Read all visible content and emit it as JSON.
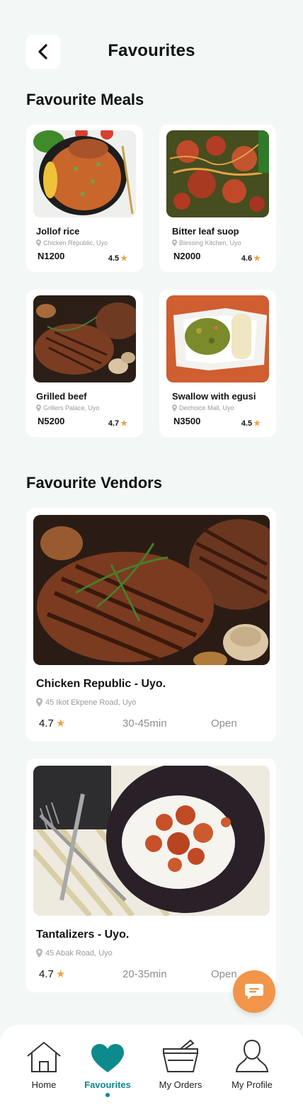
{
  "header": {
    "title": "Favourites"
  },
  "sections": {
    "meals_title": "Favourite Meals",
    "vendors_title": "Favourite Vendors"
  },
  "meals": [
    {
      "name": "Jollof rice",
      "vendor": "Chicken Republic, Uyo",
      "price": "N1200",
      "rating": "4.5"
    },
    {
      "name": "Bitter leaf suop",
      "vendor": "Blessing Kitchen, Uyo",
      "price": "N2000",
      "rating": "4.6"
    },
    {
      "name": "Grilled beef",
      "vendor": "Grillers Palace, Uyo",
      "price": "N5200",
      "rating": "4.7"
    },
    {
      "name": "Swallow with egusi",
      "vendor": "Dechoice Mall, Uyo",
      "price": "N3500",
      "rating": "4.5"
    }
  ],
  "vendors": [
    {
      "name": "Chicken Republic - Uyo.",
      "address": "45 Ikot Ekpene Road, Uyo",
      "rating": "4.7",
      "time": "30-45min",
      "status": "Open"
    },
    {
      "name": "Tantalizers - Uyo.",
      "address": "45 Abak Road, Uyo",
      "rating": "4.7",
      "time": "20-35min",
      "status": "Open"
    }
  ],
  "nav": [
    {
      "label": "Home",
      "icon": "home-icon"
    },
    {
      "label": "Favourites",
      "icon": "heart-icon"
    },
    {
      "label": "My Orders",
      "icon": "basket-icon"
    },
    {
      "label": "My Profile",
      "icon": "user-icon"
    }
  ],
  "colors": {
    "accent": "#0d8a8c",
    "star": "#f0a046",
    "fab": "#f0954a",
    "background": "#f3f8f7"
  }
}
